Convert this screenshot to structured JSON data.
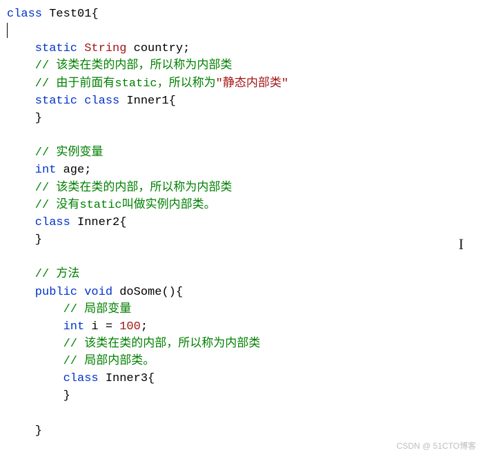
{
  "code": {
    "class_kw": "class",
    "class_name": "Test01",
    "open_brace": "{",
    "static_kw": "static",
    "string_type": "String",
    "country_var": "country",
    "semi": ";",
    "cmt_inner1a": "// 该类在类的内部，所以称为内部类",
    "cmt_inner1b_pre": "// 由于前面有static，所以称为",
    "cmt_inner1b_quoted": "\"静态内部类\"",
    "inner1_decl_kw": "static class",
    "inner1_name": "Inner1",
    "close_brace": "}",
    "cmt_instance_var": "// 实例变量",
    "int_kw": "int",
    "age_var": "age",
    "cmt_inner2a": "// 该类在类的内部，所以称为内部类",
    "cmt_inner2b": "// 没有static叫做实例内部类。",
    "class_kw2": "class",
    "inner2_name": "Inner2",
    "cmt_method": "// 方法",
    "public_kw": "public",
    "void_kw": "void",
    "method_name": "doSome",
    "paren_pair": "()",
    "cmt_local_var": "// 局部变量",
    "i_var": "i",
    "eq": "=",
    "hundred": "100",
    "cmt_inner3a": "// 该类在类的内部，所以称为内部类",
    "cmt_inner3b": "// 局部内部类。",
    "class_kw3": "class",
    "inner3_name": "Inner3"
  },
  "watermark": "CSDN @ 51CTO博客"
}
